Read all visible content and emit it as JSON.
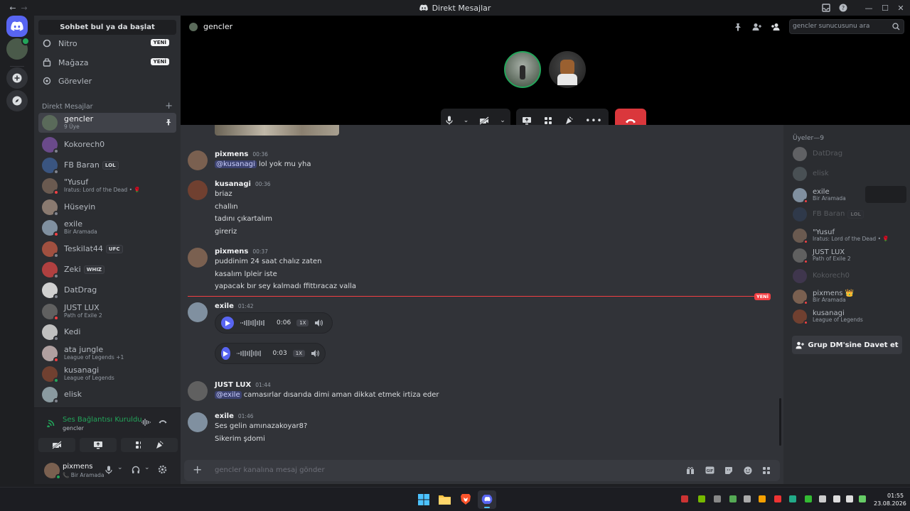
{
  "window": {
    "title": "Direkt Mesajlar"
  },
  "dm_sidebar": {
    "search_label": "Sohbet bul ya da başlat",
    "nav": [
      {
        "label": "Nitro",
        "badge": "YENİ"
      },
      {
        "label": "Mağaza",
        "badge": "YENİ"
      },
      {
        "label": "Görevler",
        "badge": ""
      }
    ],
    "dm_header": "Direkt Mesajlar",
    "dms": [
      {
        "name": "gencler",
        "sub": "9 Üye",
        "tag": "",
        "color": "#5a6a5a",
        "status": "",
        "selected": true
      },
      {
        "name": "Kokorech0",
        "sub": "",
        "tag": "",
        "color": "#6a4a8a",
        "status": "#80848e"
      },
      {
        "name": "FB Baran",
        "sub": "",
        "tag": "LOL",
        "color": "#3a5580",
        "status": "#80848e"
      },
      {
        "name": "\"Yusuf",
        "sub": "Iratus: Lord of the Dead • 🌹",
        "tag": "",
        "color": "#6a5a50",
        "status": "#f23f43"
      },
      {
        "name": "Hüseyin",
        "sub": "",
        "tag": "",
        "color": "#8a7a70",
        "status": "#80848e"
      },
      {
        "name": "exile",
        "sub": "Bir Aramada",
        "tag": "",
        "color": "#8090a0",
        "status": "#f23f43"
      },
      {
        "name": "Teskilat44",
        "sub": "",
        "tag": "UFC",
        "color": "#a05040",
        "status": "#80848e"
      },
      {
        "name": "Zeki",
        "sub": "",
        "tag": "WHIZ",
        "color": "#b04040",
        "status": "#80848e"
      },
      {
        "name": "DatDrag",
        "sub": "",
        "tag": "",
        "color": "#d0d0d0",
        "status": "#80848e"
      },
      {
        "name": "JUST LUX",
        "sub": "Path of Exile 2",
        "tag": "",
        "color": "#606060",
        "status": "#f23f43"
      },
      {
        "name": "Kedi",
        "sub": "",
        "tag": "",
        "color": "#c0c0c0",
        "status": "#80848e"
      },
      {
        "name": "ata jungle",
        "sub": "League of Legends +1",
        "tag": "",
        "color": "#b0a0a0",
        "status": "#f23f43"
      },
      {
        "name": "kusanagi",
        "sub": "League of Legends",
        "tag": "",
        "color": "#704030",
        "status": "#23a55a"
      },
      {
        "name": "elisk",
        "sub": "",
        "tag": "",
        "color": "#8a9aa0",
        "status": "#80848e"
      }
    ]
  },
  "voice_panel": {
    "status": "Ses Bağlantısı Kuruldu",
    "channel": "gencler"
  },
  "user_panel": {
    "name": "pixmens",
    "status": "Bir Aramada"
  },
  "header": {
    "channel": "gencler",
    "search_placeholder": "gencler sunucusunu ara"
  },
  "messages": [
    {
      "author": "pixmens",
      "time": "00:36",
      "lines": [
        [
          "@kusanagi",
          " lol yok mu yha"
        ]
      ]
    },
    {
      "author": "kusanagi",
      "time": "00:36",
      "lines": [
        [
          "",
          "briaz"
        ],
        [
          "",
          "challın"
        ],
        [
          "",
          "tadını çıkartalım"
        ],
        [
          "",
          "gireriz"
        ]
      ]
    },
    {
      "author": "pixmens",
      "time": "00:37",
      "lines": [
        [
          "",
          "puddinim 24 saat chalız zaten"
        ],
        [
          "",
          "kasalım lpleir iste"
        ],
        [
          "",
          "yapacak bır sey kalmadı ffittıracaz valla"
        ]
      ]
    },
    {
      "author": "exile",
      "time": "01:42",
      "audio": [
        {
          "duration": "0:06",
          "speed": "1X"
        },
        {
          "duration": "0:03",
          "speed": "1X"
        }
      ]
    },
    {
      "author": "JUST LUX",
      "time": "01:44",
      "lines": [
        [
          "@exile",
          " camasırlar dısarıda dimi aman dikkat etmek irtiza eder"
        ]
      ]
    },
    {
      "author": "exile",
      "time": "01:46",
      "lines": [
        [
          "",
          "Ses gelin amınazakoyar8?"
        ],
        [
          "",
          "Sikerim şdomi"
        ]
      ]
    }
  ],
  "new_divider": "YENİ",
  "composer": {
    "placeholder": "gencler kanalına mesaj gönder"
  },
  "members": {
    "header": "Üyeler—9",
    "list": [
      {
        "name": "DatDrag",
        "sub": "",
        "offline": true,
        "color": "#d0d0d0"
      },
      {
        "name": "elisk",
        "sub": "",
        "offline": true,
        "color": "#8a9aa0"
      },
      {
        "name": "exile",
        "sub": "Bir Aramada",
        "offline": false,
        "color": "#8090a0"
      },
      {
        "name": "FB Baran",
        "sub": "",
        "offline": true,
        "color": "#3a5580",
        "tag": "LOL"
      },
      {
        "name": "\"Yusuf",
        "sub": "Iratus: Lord of the Dead • 🌹",
        "offline": false,
        "color": "#6a5a50"
      },
      {
        "name": "JUST LUX",
        "sub": "Path of Exile 2",
        "offline": false,
        "color": "#606060"
      },
      {
        "name": "Kokorech0",
        "sub": "",
        "offline": true,
        "color": "#6a4a8a"
      },
      {
        "name": "pixmens 👑",
        "sub": "Bir Aramada",
        "offline": false,
        "color": "#7a6050"
      },
      {
        "name": "kusanagi",
        "sub": "League of Legends",
        "offline": false,
        "color": "#704030"
      }
    ],
    "invite_label": "Grup DM'sine Davet et"
  },
  "clock": {
    "time": "01:55",
    "date": "23.08.2026"
  }
}
